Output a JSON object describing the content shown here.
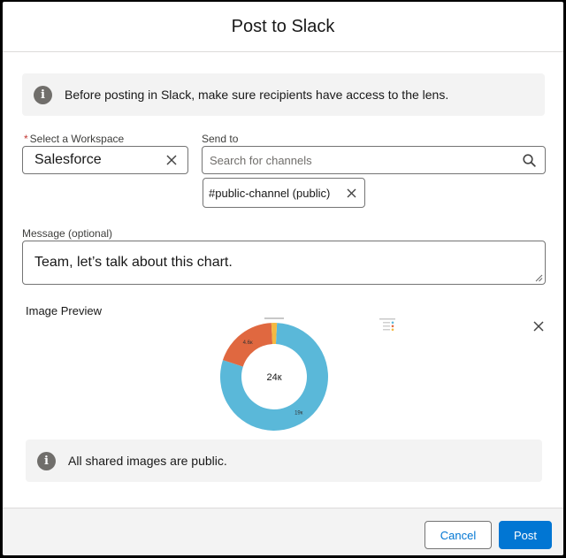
{
  "modal": {
    "title": "Post to Slack"
  },
  "info_banner": {
    "text": "Before posting in Slack, make sure recipients have access to the lens.",
    "icon": "info-icon"
  },
  "workspace": {
    "label": "Select a Workspace",
    "required_marker": "*",
    "value": "Salesforce"
  },
  "send_to": {
    "label": "Send to",
    "placeholder": "Search for channels",
    "selected_channels": [
      "#public-channel (public)"
    ]
  },
  "message": {
    "label": "Message (optional)",
    "value": "Team, let’s talk about this chart."
  },
  "image_preview": {
    "label": "Image Preview"
  },
  "chart_data": {
    "type": "pie",
    "variant": "donut",
    "center_label": "24к",
    "slices": [
      {
        "label": "19к",
        "value": 19,
        "color": "#5ab8d9"
      },
      {
        "label": "4.6к",
        "value": 4.6,
        "color": "#e06840"
      },
      {
        "label": "",
        "value": 0.4,
        "color": "#f4b942"
      }
    ],
    "legend_colors": [
      "#5ab8d9",
      "#e06840",
      "#f4b942"
    ],
    "legend_placement": "top-right"
  },
  "public_notice": {
    "text": "All shared images are public.",
    "icon": "info-icon"
  },
  "footer": {
    "cancel_label": "Cancel",
    "post_label": "Post"
  },
  "colors": {
    "brand": "#0176d3",
    "info_bg": "#f3f3f3",
    "required": "#c23934"
  }
}
